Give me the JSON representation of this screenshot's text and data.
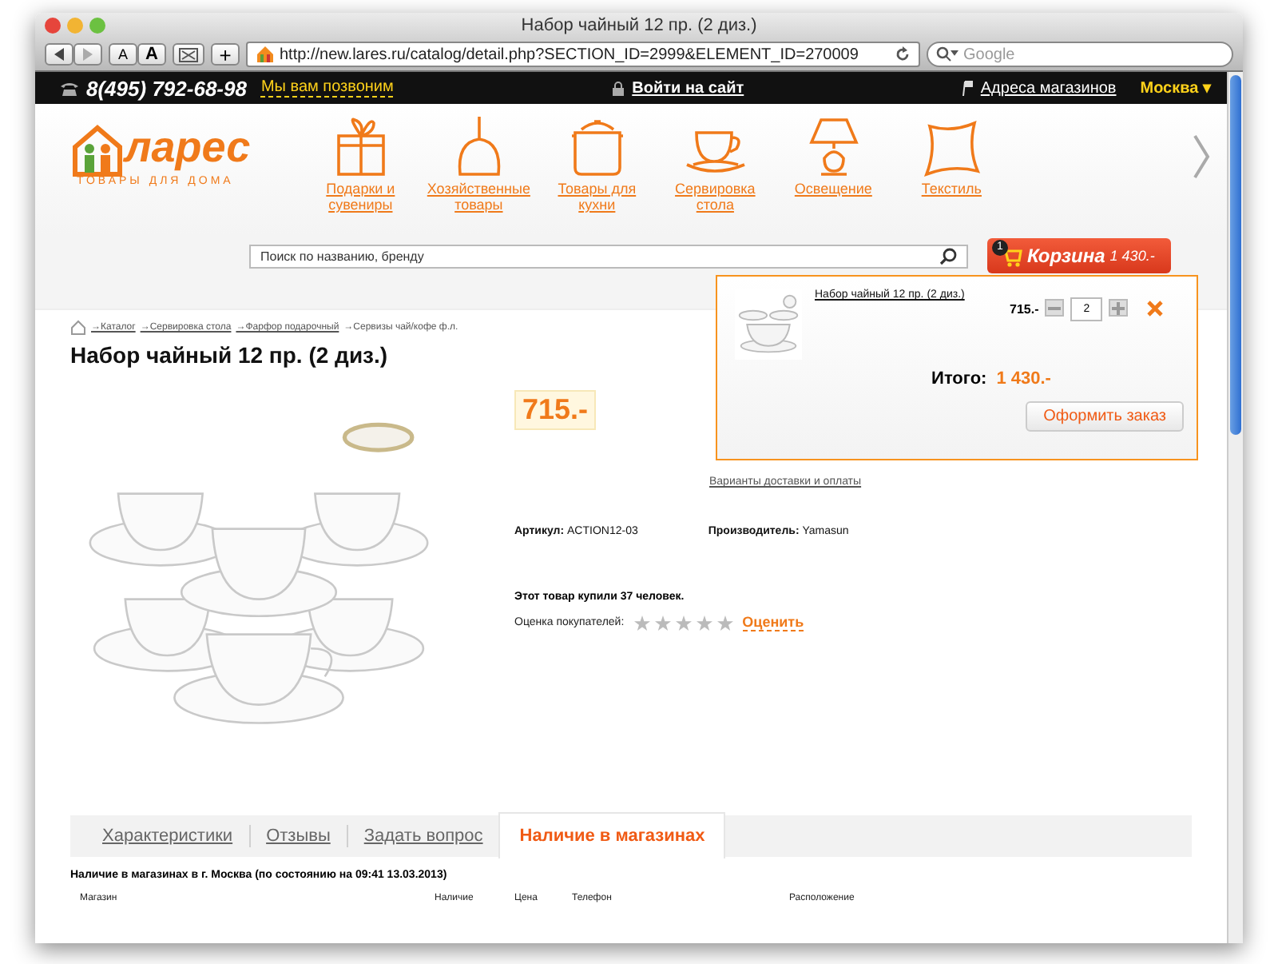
{
  "window": {
    "title": "Набор чайный 12 пр. (2 диз.)"
  },
  "toolbar": {
    "font_small": "A",
    "font_large": "A",
    "add": "+",
    "url": "http://new.lares.ru/catalog/detail.php?SECTION_ID=2999&ELEMENT_ID=270009",
    "search_placeholder": "Google"
  },
  "topbar": {
    "phone": "8(495) 792-68-98",
    "callback": "Мы вам позвоним",
    "login": "Войти на сайт",
    "stores": "Адреса магазинов",
    "city": "Москва ▾"
  },
  "logo": {
    "name": "ларес",
    "tagline": "ТОВАРЫ ДЛЯ ДОМА"
  },
  "categories": [
    {
      "label": "Подарки и сувениры",
      "kind": "gift"
    },
    {
      "label": "Хозяйственные товары",
      "kind": "dustpan"
    },
    {
      "label": "Товары для кухни",
      "kind": "pot"
    },
    {
      "label": "Сервировка стола",
      "kind": "cup"
    },
    {
      "label": "Освещение",
      "kind": "lamp"
    },
    {
      "label": "Текстиль",
      "kind": "pillow"
    }
  ],
  "search": {
    "placeholder": "Поиск по названию, бренду"
  },
  "cart_button": {
    "count": "1",
    "label": "Корзина",
    "total": "1 430.-"
  },
  "breadcrumbs": [
    {
      "label": "→Каталог",
      "link": true
    },
    {
      "label": "→Сервировка стола",
      "link": true
    },
    {
      "label": "→Фарфор подарочный",
      "link": true
    },
    {
      "label": "→Сервизы чай/кофе ф.л.",
      "link": false
    }
  ],
  "product": {
    "title": "Набор чайный 12 пр. (2 диз.)",
    "price": "715.-",
    "delivery_link": "Варианты доставки и оплаты",
    "article_label": "Артикул:",
    "article": "ACTION12-03",
    "maker_label": "Производитель:",
    "maker": "Yamasun",
    "bought": "Этот товар купили 37 человек.",
    "rating_label": "Оценка покупателей:",
    "stars": 0,
    "rate_link": "Оценить"
  },
  "cart_popup": {
    "item": "Набор чайный 12 пр. (2 диз.)",
    "price": "715.-",
    "quantity": "2",
    "total_label": "Итого:",
    "total": "1 430.-",
    "checkout": "Оформить заказ"
  },
  "tabs": [
    {
      "label": "Характеристики",
      "selected": false
    },
    {
      "label": "Отзывы",
      "selected": false
    },
    {
      "label": "Задать вопрос",
      "selected": false
    },
    {
      "label": "Наличие в магазинах",
      "selected": true
    }
  ],
  "availability": {
    "caption": "Наличие в магазинах в г. Москва (по состоянию на 09:41 13.03.2013)",
    "columns": [
      "Магазин",
      "Наличие",
      "Цена",
      "Телефон",
      "Расположение"
    ]
  }
}
